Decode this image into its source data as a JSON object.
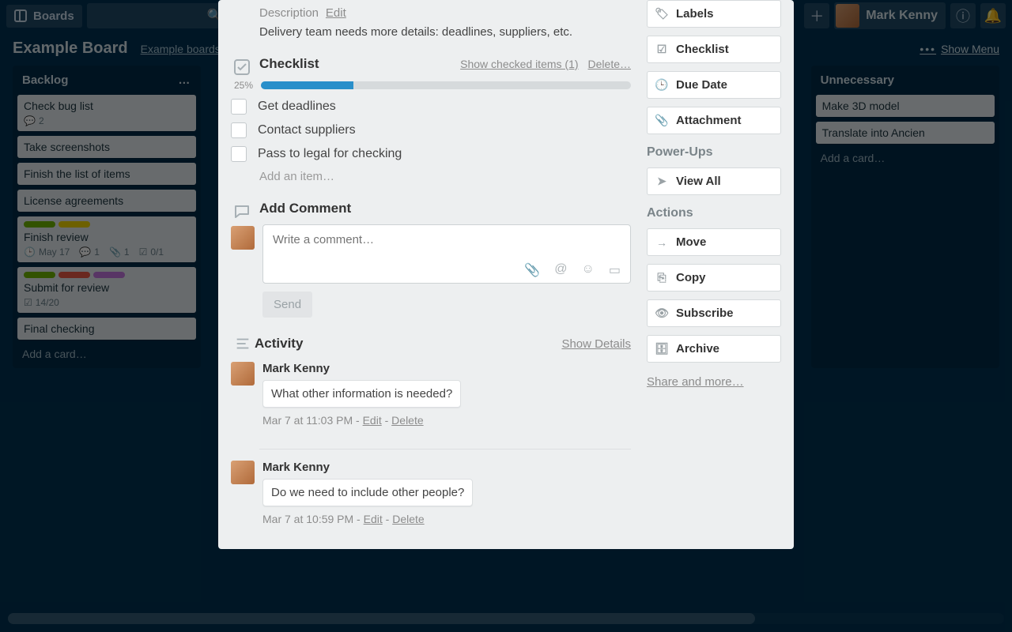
{
  "header": {
    "boards_label": "Boards",
    "user_name": "Mark Kenny"
  },
  "board": {
    "title": "Example Board",
    "breadcrumb": "Example boards",
    "show_menu": "Show Menu"
  },
  "lists": {
    "backlog": {
      "title": "Backlog",
      "cards": {
        "c0": {
          "title": "Check bug list",
          "comments": "2"
        },
        "c1": {
          "title": "Take screenshots"
        },
        "c2": {
          "title": "Finish the list of items"
        },
        "c3": {
          "title": "License agreements"
        },
        "c4": {
          "title": "Finish review",
          "due": "May 17",
          "comments": "1",
          "attach": "1",
          "chk": "0/1"
        },
        "c5": {
          "title": "Submit for review",
          "chk": "14/20"
        },
        "c6": {
          "title": "Final checking"
        }
      },
      "add": "Add a card…"
    },
    "unnecessary": {
      "title": "Unnecessary",
      "cards": {
        "c0": {
          "title": "Make 3D model"
        },
        "c1": {
          "title": "Translate into Ancien"
        }
      },
      "add": "Add a card…"
    }
  },
  "card": {
    "description_label": "Description",
    "edit": "Edit",
    "description": "Delivery team needs more details: deadlines, suppliers, etc.",
    "checklist": {
      "title": "Checklist",
      "show_checked": "Show checked items (1)",
      "delete": "Delete…",
      "percent": "25%",
      "percent_val": 25,
      "items": {
        "i0": "Get deadlines",
        "i1": "Contact suppliers",
        "i2": "Pass to legal for checking"
      },
      "add_item": "Add an item…"
    },
    "comment": {
      "title": "Add Comment",
      "placeholder": "Write a comment…",
      "send": "Send"
    },
    "activity": {
      "title": "Activity",
      "show_details": "Show Details",
      "items": {
        "a0": {
          "name": "Mark Kenny",
          "text": "What other information is needed?",
          "time": "Mar 7 at 11:03 PM",
          "edit": "Edit",
          "delete": "Delete"
        },
        "a1": {
          "name": "Mark Kenny",
          "text": "Do we need to include other people?",
          "time": "Mar 7 at 10:59 PM",
          "edit": "Edit",
          "delete": "Delete"
        }
      }
    },
    "sidebar": {
      "add_labels": "Labels",
      "add_checklist": "Checklist",
      "add_due": "Due Date",
      "add_attach": "Attachment",
      "powerups_title": "Power-Ups",
      "view_all": "View All",
      "actions_title": "Actions",
      "move": "Move",
      "copy": "Copy",
      "subscribe": "Subscribe",
      "archive": "Archive",
      "share": "Share and more…"
    }
  }
}
